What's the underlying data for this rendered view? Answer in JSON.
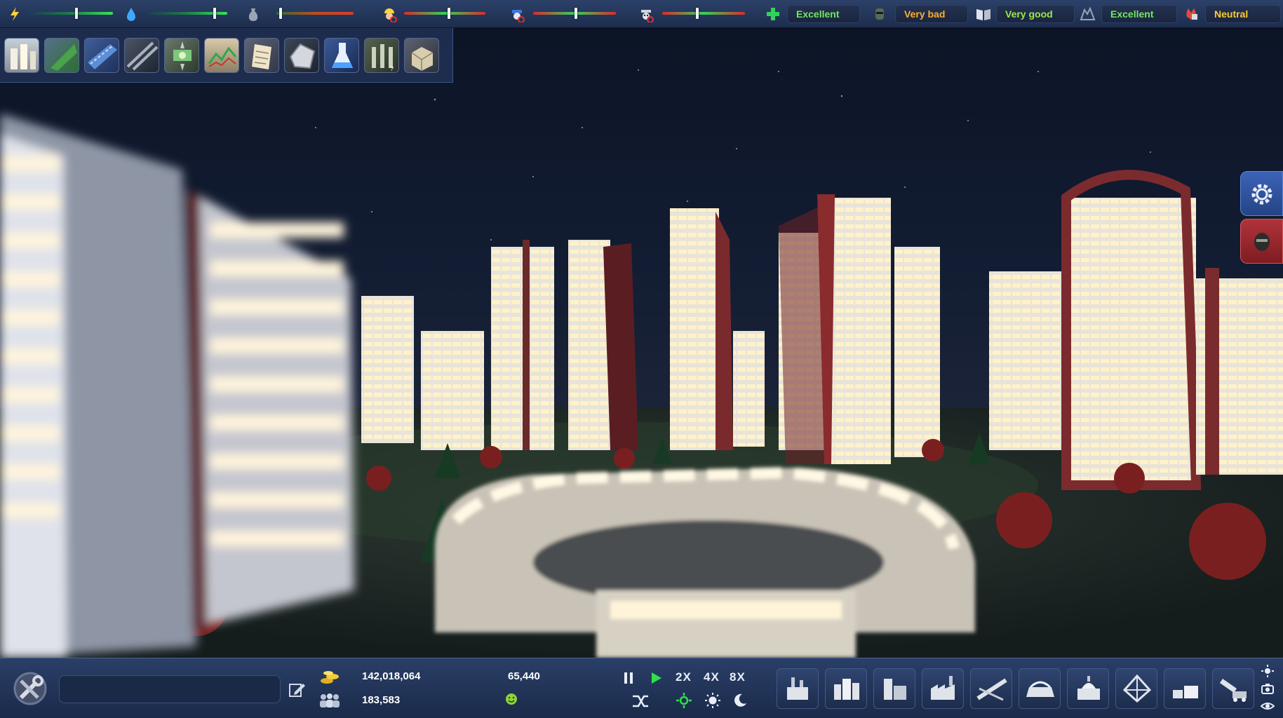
{
  "top_bar": {
    "resources": [
      {
        "icon": "electricity-icon",
        "level": 0.58
      },
      {
        "icon": "water-icon",
        "level": 0.85
      },
      {
        "icon": "waste-icon",
        "level": 0.05
      },
      {
        "icon": "construction-worker-icon",
        "level": 0.55
      },
      {
        "icon": "police-icon",
        "level": 0.52
      },
      {
        "icon": "pollution-icon",
        "level": 0.42
      }
    ],
    "statuses": [
      {
        "icon": "health-cross-icon",
        "label": "Excellent",
        "color": "#74e85c"
      },
      {
        "icon": "crime-mask-icon",
        "label": "Very bad",
        "color": "#ffae2e"
      },
      {
        "icon": "education-book-icon",
        "label": "Very good",
        "color": "#9be84a"
      },
      {
        "icon": "environment-icon",
        "label": "Excellent",
        "color": "#74e85c"
      },
      {
        "icon": "happiness-flame-icon",
        "label": "Neutral",
        "color": "#ffcc2e"
      }
    ]
  },
  "categories": [
    "residential-category-icon",
    "parks-category-icon",
    "roads-category-icon",
    "rail-category-icon",
    "economy-category-icon",
    "statistics-category-icon",
    "policies-category-icon",
    "minerals-category-icon",
    "research-category-icon",
    "monuments-category-icon",
    "warehouse-category-icon"
  ],
  "side_buttons": [
    "settings-gear-icon",
    "advisor-face-icon"
  ],
  "bottom_bar": {
    "city_name_value": "",
    "money": "142,018,064",
    "population": "183,583",
    "income": "65,440",
    "speed_labels": [
      "2X",
      "4X",
      "8X"
    ],
    "build_tools": [
      "power-plant-icon",
      "residential-building-icon",
      "commercial-building-icon",
      "industrial-building-icon",
      "road-tool-icon",
      "transport-station-icon",
      "public-service-icon",
      "landmark-icon",
      "storage-icon",
      "bulldozer-icon"
    ],
    "right_icons": [
      "weather-icon",
      "camera-icon",
      "view-eye-icon"
    ]
  }
}
